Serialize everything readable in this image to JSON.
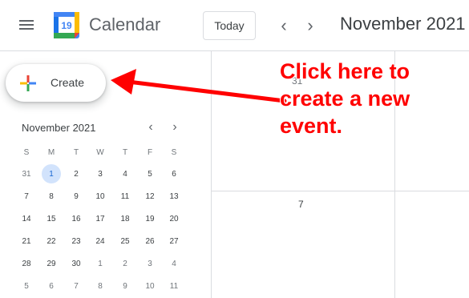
{
  "header": {
    "app_title": "Calendar",
    "logo_number": "19",
    "today_label": "Today",
    "prev_icon": "chevron-left-icon",
    "next_icon": "chevron-right-icon",
    "month_title": "November 2021"
  },
  "create_button": {
    "label": "Create",
    "icon": "plus-icon"
  },
  "mini_calendar": {
    "title": "November 2021",
    "weekdays": [
      "S",
      "M",
      "T",
      "W",
      "T",
      "F",
      "S"
    ],
    "weeks": [
      [
        {
          "d": "31",
          "muted": true
        },
        {
          "d": "1",
          "selected": true
        },
        {
          "d": "2"
        },
        {
          "d": "3"
        },
        {
          "d": "4"
        },
        {
          "d": "5"
        },
        {
          "d": "6"
        }
      ],
      [
        {
          "d": "7"
        },
        {
          "d": "8"
        },
        {
          "d": "9"
        },
        {
          "d": "10"
        },
        {
          "d": "11"
        },
        {
          "d": "12"
        },
        {
          "d": "13"
        }
      ],
      [
        {
          "d": "14"
        },
        {
          "d": "15"
        },
        {
          "d": "16"
        },
        {
          "d": "17"
        },
        {
          "d": "18"
        },
        {
          "d": "19"
        },
        {
          "d": "20"
        }
      ],
      [
        {
          "d": "21"
        },
        {
          "d": "22"
        },
        {
          "d": "23"
        },
        {
          "d": "24"
        },
        {
          "d": "25"
        },
        {
          "d": "26"
        },
        {
          "d": "27"
        }
      ],
      [
        {
          "d": "28"
        },
        {
          "d": "29"
        },
        {
          "d": "30"
        },
        {
          "d": "1",
          "muted": true
        },
        {
          "d": "2",
          "muted": true
        },
        {
          "d": "3",
          "muted": true
        },
        {
          "d": "4",
          "muted": true
        }
      ],
      [
        {
          "d": "5",
          "muted": true
        },
        {
          "d": "6",
          "muted": true
        },
        {
          "d": "7",
          "muted": true
        },
        {
          "d": "8",
          "muted": true
        },
        {
          "d": "9",
          "muted": true
        },
        {
          "d": "10",
          "muted": true
        },
        {
          "d": "11",
          "muted": true
        }
      ]
    ]
  },
  "main_grid": {
    "top_cell_day": "31",
    "second_row_day": "7"
  },
  "annotation": {
    "text": "Click here to\ncreate a new\nevent.",
    "color": "#ff0000"
  },
  "colors": {
    "selected_bg": "#d2e3fc",
    "selected_text": "#1967d2",
    "border": "#dadce0"
  }
}
